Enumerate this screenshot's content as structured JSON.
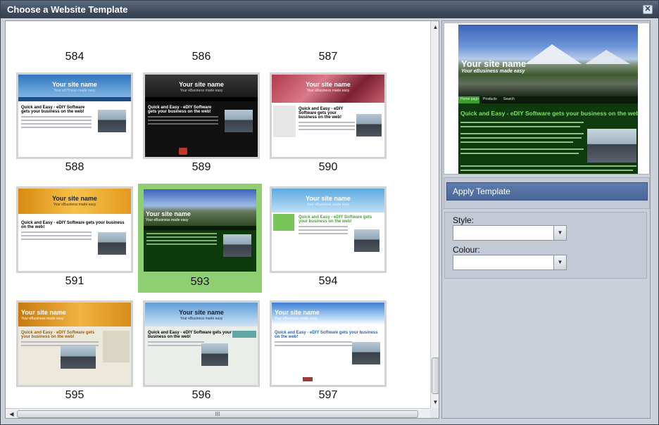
{
  "window": {
    "title": "Choose a Website Template",
    "close_glyph": "✕"
  },
  "templates": [
    {
      "id": "584",
      "row": "cut"
    },
    {
      "id": "586",
      "row": "cut"
    },
    {
      "id": "587",
      "row": "cut"
    },
    {
      "id": "588",
      "site_name": "Your site name",
      "slogan": "Your eDIYness made easy",
      "heading": "Quick and Easy - eDIY Software gets your business on the web!"
    },
    {
      "id": "589",
      "site_name": "Your site name",
      "slogan": "Your eBusiness made easy",
      "heading": "Quick and Easy - eDIY Software gets your business on the web!"
    },
    {
      "id": "590",
      "site_name": "Your site name",
      "slogan": "Your eBusiness made easy",
      "heading": "Quick and Easy - eDIY Software gets your business on the web!"
    },
    {
      "id": "591",
      "site_name": "Your site name",
      "slogan": "Your eBusiness made easy",
      "heading": "Quick and Easy - eDIY Software gets your business on the web!"
    },
    {
      "id": "593",
      "site_name": "Your site name",
      "slogan": "Your eBusiness made easy",
      "heading": "",
      "selected": true
    },
    {
      "id": "594",
      "site_name": "Your site name",
      "slogan": "Your eBusiness made easy",
      "heading": "Quick and Easy - eDIY Software gets your business on the web!"
    },
    {
      "id": "595",
      "site_name": "Your site name",
      "slogan": "Your eBusiness made easy",
      "heading": "Quick and Easy - eDIY Software gets your business on the web!"
    },
    {
      "id": "596",
      "site_name": "Your site name",
      "slogan": "Your eBusiness made easy",
      "heading": "Quick and Easy - eDIY Software gets your business on the web!"
    },
    {
      "id": "597",
      "site_name": "Your site name",
      "slogan": "Your eBusiness made easy",
      "heading": "Quick and Easy - eDIY Software gets your business on the web!"
    }
  ],
  "preview": {
    "site_name": "Your site name",
    "slogan": "Your eBusiness made easy",
    "nav": [
      "Home page",
      "Products",
      "Search"
    ],
    "heading": "Quick and Easy - eDIY Software gets your business on the web!"
  },
  "panel": {
    "apply_label": "Apply Template",
    "style_label": "Style:",
    "style_value": "",
    "colour_label": "Colour:",
    "colour_value": ""
  },
  "scrollbar": {
    "grip": "III",
    "up": "▲",
    "down": "▼",
    "left": "◀",
    "right": "▶"
  }
}
